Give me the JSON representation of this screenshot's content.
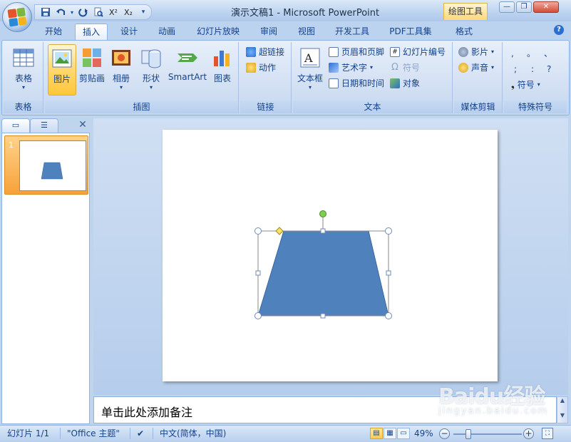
{
  "app": {
    "title": "演示文稿1 - Microsoft PowerPoint",
    "contextual_tab": "绘图工具"
  },
  "qat": {
    "save": "save-icon",
    "undo": "undo-icon",
    "redo": "redo-icon",
    "preview": "print-preview-icon",
    "superscript": "X²",
    "subscript": "X₂",
    "customize": "▾"
  },
  "window_controls": {
    "minimize": "—",
    "restore": "❐",
    "close": "✕"
  },
  "tabs": [
    {
      "label": "开始"
    },
    {
      "label": "插入",
      "active": true
    },
    {
      "label": "设计"
    },
    {
      "label": "动画"
    },
    {
      "label": "幻灯片放映"
    },
    {
      "label": "审阅"
    },
    {
      "label": "视图"
    },
    {
      "label": "开发工具"
    },
    {
      "label": "PDF工具集"
    },
    {
      "label": "格式"
    }
  ],
  "help": "?",
  "ribbon": {
    "groups": {
      "table": {
        "label": "表格",
        "buttons": {
          "table": "表格"
        }
      },
      "illustrations": {
        "label": "插图",
        "buttons": {
          "picture": "图片",
          "clipart": "剪贴画",
          "album": "相册",
          "shapes": "形状",
          "smartart": "SmartArt",
          "chart": "图表"
        }
      },
      "links": {
        "label": "链接",
        "buttons": {
          "hyperlink": "超链接",
          "action": "动作"
        }
      },
      "text": {
        "label": "文本",
        "buttons": {
          "textbox": "文本框",
          "header_footer": "页眉和页脚",
          "wordart": "艺术字",
          "datetime": "日期和时间",
          "slide_number": "幻灯片编号",
          "symbol": "符号",
          "object": "对象"
        }
      },
      "media": {
        "label": "媒体剪辑",
        "buttons": {
          "movie": "影片",
          "sound": "声音"
        }
      },
      "special": {
        "label": "特殊符号",
        "symbols": [
          ",",
          "。",
          "、",
          ";",
          ":",
          "?"
        ],
        "symbol_button": "符号"
      }
    }
  },
  "pane": {
    "close": "✕",
    "slide_number": "1"
  },
  "colors": {
    "shape_fill": "#4f81bd",
    "shape_outline": "#3c679b",
    "handle": "#ffffff",
    "rotate_handle": "#7ed04b",
    "adjust_handle": "#f7e36a",
    "accent": "#15428b"
  },
  "notes": {
    "placeholder": "单击此处添加备注"
  },
  "status": {
    "slide": "幻灯片 1/1",
    "theme": "\"Office 主题\"",
    "language": "中文(简体，中国)",
    "zoom": "49%",
    "zoom_level": 0.49
  },
  "watermark": {
    "text": "Baidu经验",
    "sub": "jingyan.baidu.com"
  }
}
